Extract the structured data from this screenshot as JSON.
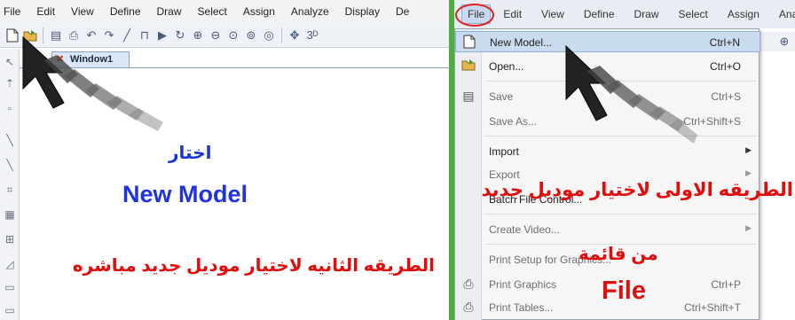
{
  "left_panel": {
    "menu": [
      "File",
      "Edit",
      "View",
      "Define",
      "Draw",
      "Select",
      "Assign",
      "Analyze",
      "Display",
      "De"
    ],
    "window_tab": "Window1",
    "choose_text": "اختار",
    "new_model_text": "New Model",
    "method2_text": "الطريقه الثانيه لاختيار موديل جديد مباشره"
  },
  "right_panel": {
    "menu": [
      "File",
      "Edit",
      "View",
      "Define",
      "Draw",
      "Select",
      "Assign",
      "Analyze"
    ],
    "file_menu": [
      {
        "label": "New Model...",
        "shortcut": "Ctrl+N",
        "icon": "new-file-icon"
      },
      {
        "label": "Open...",
        "shortcut": "Ctrl+O",
        "icon": "open-folder-icon"
      },
      {
        "label": "Save",
        "shortcut": "Ctrl+S",
        "icon": "save-disk-icon"
      },
      {
        "label": "Save As...",
        "shortcut": "Ctrl+Shift+S"
      },
      {
        "label": "Import",
        "submenu": true
      },
      {
        "label": "Export",
        "submenu": true
      },
      {
        "label": "Batch File Control..."
      },
      {
        "label": "Create Video...",
        "submenu": true
      },
      {
        "label": "Print Setup for Graphics..."
      },
      {
        "label": "Print Graphics",
        "shortcut": "Ctrl+P",
        "icon": "print-icon"
      },
      {
        "label": "Print Tables...",
        "shortcut": "Ctrl+Shift+T",
        "icon": "print-icon"
      }
    ],
    "method1_text": "الطريقه الاولى لاختيار موديل جديد",
    "from_list_text": "من قائمة",
    "file_text": "File"
  },
  "colors": {
    "blue_text": "#1f33e0",
    "red_text": "#e10d0d",
    "divider_green": "#4cae3a",
    "menu_highlight": "#c9dbef"
  }
}
